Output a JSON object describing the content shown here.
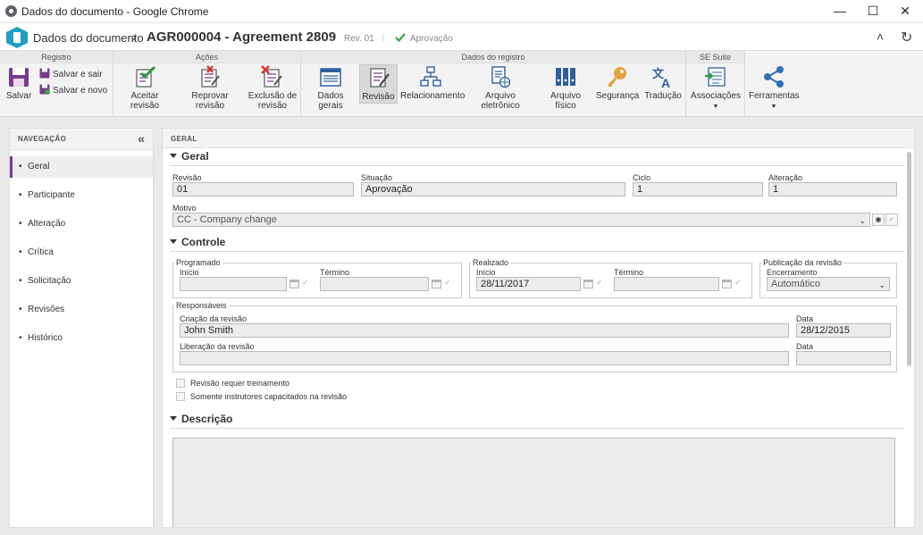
{
  "window": {
    "title": "Dados do documento - Google Chrome"
  },
  "header": {
    "crumb": "Dados do documento",
    "doc_id_title": "AGR000004 - Agreement 2809",
    "revision_label": "Rev. 01",
    "status": "Aprovação",
    "sep": "|"
  },
  "ribbon": {
    "groups": {
      "registro": "Registro",
      "acoes": "Ações",
      "dados_registro": "Dados do registro",
      "se_suite": "SE Suite"
    },
    "salvar": "Salvar",
    "salvar_sair": "Salvar e sair",
    "salvar_novo": "Salvar e novo",
    "aceitar": "Aceitar revisão",
    "reprovar": "Reprovar revisão",
    "exclusao_1": "Exclusão de",
    "exclusao_2": "revisão",
    "dados_gerais": "Dados gerais",
    "revisao": "Revisão",
    "relacionamento": "Relacionamento",
    "arquivo_eletronico": "Arquivo eletrônico",
    "arquivo_fisico": "Arquivo físico",
    "seguranca": "Segurança",
    "traducao": "Tradução",
    "associacoes": "Associações",
    "ferramentas": "Ferramentas"
  },
  "nav": {
    "title": "NAVEGAÇÃO",
    "items": [
      "Geral",
      "Participante",
      "Alteração",
      "Crítica",
      "Solicitação",
      "Revisões",
      "Histórico"
    ]
  },
  "main": {
    "title": "GERAL",
    "sections": {
      "geral": "Geral",
      "controle": "Controle",
      "descricao": "Descrição"
    },
    "geral": {
      "revisao_label": "Revisão",
      "revisao_value": "01",
      "situacao_label": "Situação",
      "situacao_value": "Aprovação",
      "ciclo_label": "Ciclo",
      "ciclo_value": "1",
      "alteracao_label": "Alteração",
      "alteracao_value": "1",
      "motivo_label": "Motivo",
      "motivo_value": "CC - Company change"
    },
    "controle": {
      "programado": "Programado",
      "realizado": "Realizado",
      "publicacao": "Publicação da revisão",
      "inicio": "Início",
      "termino": "Término",
      "realizado_inicio_value": "28/11/2017",
      "encerramento_label": "Encerramento",
      "encerramento_value": "Automático",
      "responsaveis": "Responsáveis",
      "criacao_label": "Criação da revisão",
      "criacao_value": "John Smith",
      "data_label": "Data",
      "criacao_data_value": "28/12/2015",
      "liberacao_label": "Liberação da revisão",
      "checkbox_treinamento": "Revisão requer treinamento",
      "checkbox_instrutores": "Somente instrutores capacitados na revisão"
    }
  },
  "colors": {
    "accent": "#7a3b8f",
    "logo": "#1f9fc3",
    "ok_green": "#3aa644"
  }
}
